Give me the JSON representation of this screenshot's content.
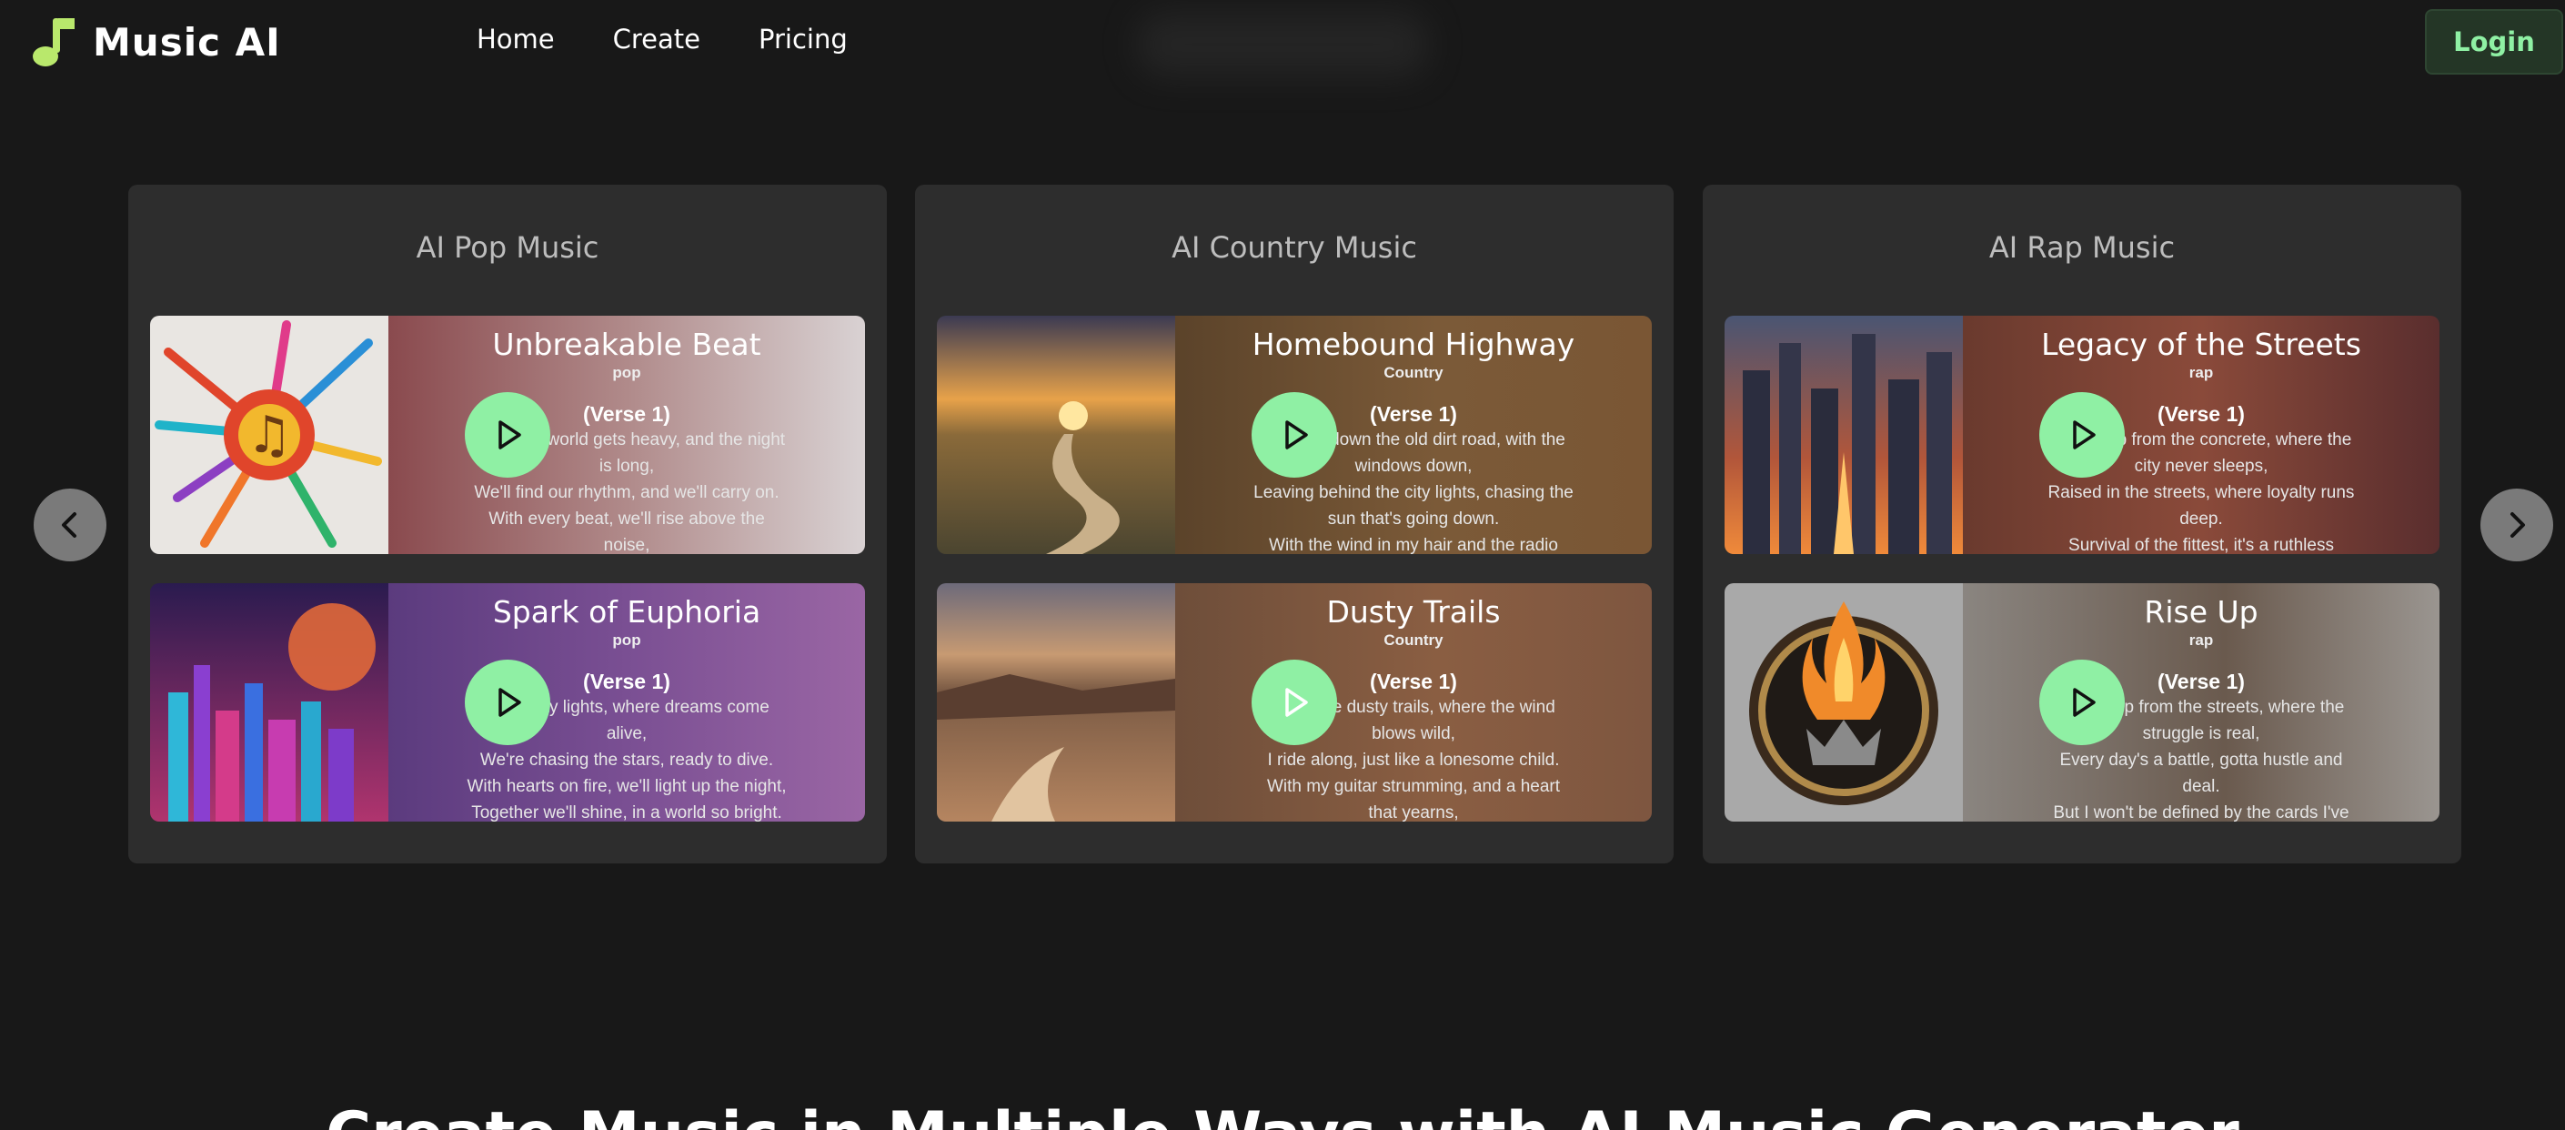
{
  "header": {
    "brand": "Music AI",
    "nav": [
      "Home",
      "Create",
      "Pricing"
    ],
    "login_label": "Login"
  },
  "colors": {
    "accent": "#8ff0a4",
    "page_bg": "#181818",
    "panel_bg": "#2d2d2d"
  },
  "carousel": {
    "prev_icon": "chevron-left-icon",
    "next_icon": "chevron-right-icon",
    "panels": [
      {
        "title": "AI Pop Music",
        "songs": [
          {
            "title": "Unbreakable Beat",
            "genre": "pop",
            "verse": "(Verse 1)",
            "lyrics": "When the world gets heavy, and the night is long,\nWe'll find our rhythm, and we'll carry on.\nWith every beat, we'll rise above the noise,\nIn this pop anthem, we'll find our voice."
          },
          {
            "title": "Spark of Euphoria",
            "genre": "pop",
            "verse": "(Verse 1)",
            "lyrics": "In the city lights, where dreams come alive,\nWe're chasing the stars, ready to dive.\nWith hearts on fire, we'll light up the night,\nTogether we'll shine, in a world so bright."
          }
        ]
      },
      {
        "title": "AI Country Music",
        "songs": [
          {
            "title": "Homebound Highway",
            "genre": "Country",
            "verse": "(Verse 1)",
            "lyrics": "Cruising down the old dirt road, with the windows down,\nLeaving behind the city lights, chasing the sun that's going down.\nWith the wind in my hair and the radio"
          },
          {
            "title": "Dusty Trails",
            "genre": "Country",
            "verse": "(Verse 1)",
            "lyrics": "On these dusty trails, where the wind blows wild,\nI ride along, just like a lonesome child.\nWith my guitar strumming, and a heart that yearns,"
          }
        ]
      },
      {
        "title": "AI Rap Music",
        "songs": [
          {
            "title": "Legacy of the Streets",
            "genre": "rap",
            "verse": "(Verse 1)",
            "lyrics": "I came up from the concrete, where the city never sleeps,\nRaised in the streets, where loyalty runs deep.\nSurvival of the fittest, it's a ruthless"
          },
          {
            "title": "Rise Up",
            "genre": "rap",
            "verse": "(Verse 1)",
            "lyrics": "I came up from the streets, where the struggle is real,\nEvery day's a battle, gotta hustle and deal.\nBut I won't be defined by the cards I've been dealt."
          }
        ]
      }
    ]
  },
  "bottom_heading": "Create Music in Multiple Ways with AI Music Generator"
}
